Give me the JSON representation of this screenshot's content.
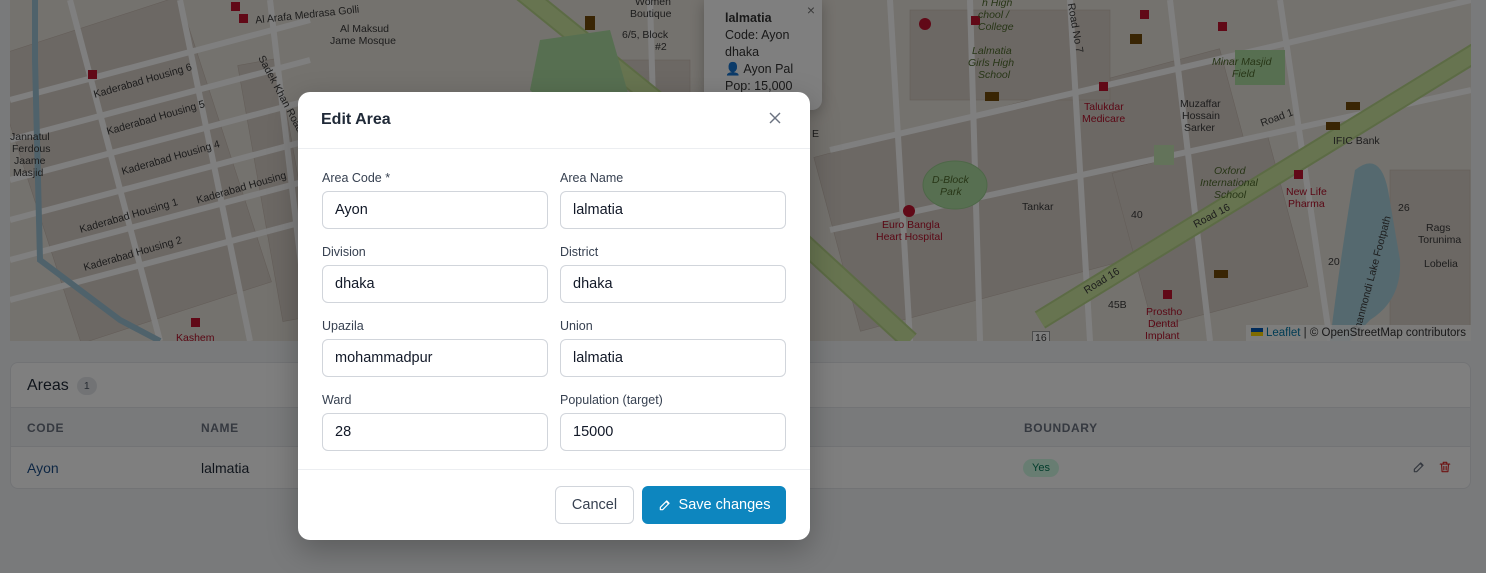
{
  "map": {
    "labels": [
      {
        "text": "Al Arafa Medrasa Golli",
        "cls": ""
      },
      {
        "text": "Al Maksud",
        "cls": ""
      },
      {
        "text": "Jame Mosque",
        "cls": ""
      },
      {
        "text": "Kaderabad Housing 6",
        "cls": ""
      },
      {
        "text": "Kaderabad Housing 5",
        "cls": ""
      },
      {
        "text": "Kaderabad Housing 4",
        "cls": ""
      },
      {
        "text": "Kaderabad Housing 1",
        "cls": ""
      },
      {
        "text": "Kaderabad Housing 2",
        "cls": ""
      },
      {
        "text": "Kaderabad Housing",
        "cls": ""
      },
      {
        "text": "Sadek Khan Road",
        "cls": ""
      },
      {
        "text": "Jannatul",
        "cls": ""
      },
      {
        "text": "Ferdous",
        "cls": ""
      },
      {
        "text": "Jaame",
        "cls": ""
      },
      {
        "text": "Masjid",
        "cls": ""
      },
      {
        "text": "Kashem",
        "cls": "red"
      },
      {
        "text": "Women",
        "cls": ""
      },
      {
        "text": "Boutique",
        "cls": ""
      },
      {
        "text": "6/5, Block",
        "cls": ""
      },
      {
        "text": "#2",
        "cls": ""
      },
      {
        "text": "Lalmatia",
        "cls": "italic"
      },
      {
        "text": "Girls High",
        "cls": "italic"
      },
      {
        "text": "School",
        "cls": "italic"
      },
      {
        "text": "h High",
        "cls": "italic"
      },
      {
        "text": "chool /",
        "cls": "italic"
      },
      {
        "text": "College",
        "cls": "italic"
      },
      {
        "text": "Road No 7",
        "cls": ""
      },
      {
        "text": "Minar Masjid",
        "cls": "italic"
      },
      {
        "text": "Field",
        "cls": "italic"
      },
      {
        "text": "Talukdar",
        "cls": "red"
      },
      {
        "text": "Medicare",
        "cls": "red"
      },
      {
        "text": "Muzaffar",
        "cls": ""
      },
      {
        "text": "Hossain",
        "cls": ""
      },
      {
        "text": "Sarker",
        "cls": ""
      },
      {
        "text": "IFIC Bank",
        "cls": ""
      },
      {
        "text": "Road 1",
        "cls": ""
      },
      {
        "text": "D-Block",
        "cls": "italic"
      },
      {
        "text": "Park",
        "cls": "italic"
      },
      {
        "text": "Tankar",
        "cls": ""
      },
      {
        "text": "Oxford",
        "cls": "italic"
      },
      {
        "text": "International",
        "cls": "italic"
      },
      {
        "text": "School",
        "cls": "italic"
      },
      {
        "text": "New Life",
        "cls": "red"
      },
      {
        "text": "Pharma",
        "cls": "red"
      },
      {
        "text": "Euro Bangla",
        "cls": "red"
      },
      {
        "text": "Heart Hospital",
        "cls": "red"
      },
      {
        "text": "Road 16",
        "cls": ""
      },
      {
        "text": "Road 16",
        "cls": ""
      },
      {
        "text": "Prostho",
        "cls": "red"
      },
      {
        "text": "Dental",
        "cls": "red"
      },
      {
        "text": "Implant",
        "cls": "red"
      },
      {
        "text": "Rags",
        "cls": ""
      },
      {
        "text": "Torunima",
        "cls": ""
      },
      {
        "text": "Lobelia",
        "cls": ""
      },
      {
        "text": "Dhanmondi Lake Footpath",
        "cls": ""
      },
      {
        "text": "40",
        "cls": ""
      },
      {
        "text": "45B",
        "cls": ""
      },
      {
        "text": "16",
        "cls": ""
      },
      {
        "text": "26",
        "cls": ""
      },
      {
        "text": "20",
        "cls": ""
      },
      {
        "text": "E",
        "cls": ""
      }
    ],
    "popup": {
      "title": "lalmatia",
      "code_line": "Code: Ayon",
      "division_line": "dhaka",
      "owner_line": "👤 Ayon Pal",
      "pop_line": "Pop: 15,000",
      "close": "×"
    },
    "attribution": {
      "leaflet": "Leaflet",
      "rest": " | © OpenStreetMap contributors"
    }
  },
  "areas": {
    "title": "Areas",
    "count": "1",
    "columns": [
      "CODE",
      "NAME",
      "BOUNDARY"
    ],
    "rows": [
      {
        "code": "Ayon",
        "name": "lalmatia",
        "boundary": "Yes"
      }
    ]
  },
  "modal": {
    "title": "Edit Area",
    "fields": {
      "area_code": {
        "label": "Area Code *",
        "value": "Ayon"
      },
      "area_name": {
        "label": "Area Name",
        "value": "lalmatia"
      },
      "division": {
        "label": "Division",
        "value": "dhaka"
      },
      "district": {
        "label": "District",
        "value": "dhaka"
      },
      "upazila": {
        "label": "Upazila",
        "value": "mohammadpur"
      },
      "union": {
        "label": "Union",
        "value": "lalmatia"
      },
      "ward": {
        "label": "Ward",
        "value": "28"
      },
      "population": {
        "label": "Population (target)",
        "value": "15000"
      }
    },
    "cancel_label": "Cancel",
    "save_label": "Save changes"
  },
  "colors": {
    "primary": "#0d86bf",
    "road_green": "#cfe8a0",
    "park": "#aedfa3",
    "water": "#aad3df",
    "building": "#d9d0c9",
    "hospital": "#c2122f"
  }
}
